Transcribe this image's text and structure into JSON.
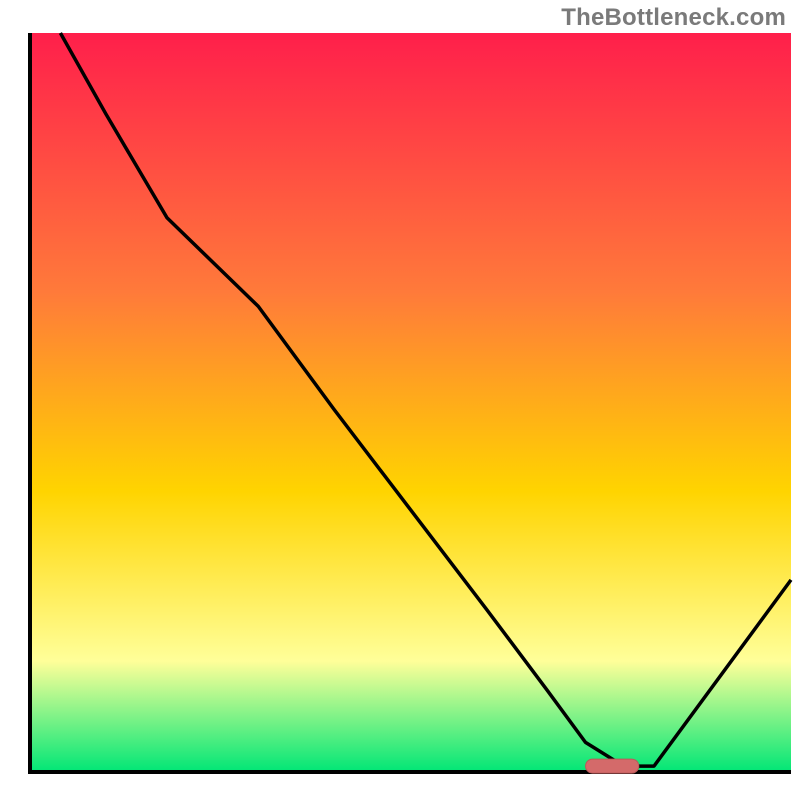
{
  "watermark": "TheBottleneck.com",
  "colors": {
    "gradient_top": "#ff1f4b",
    "gradient_mid1": "#ff7a3a",
    "gradient_mid2": "#ffd400",
    "gradient_pale": "#ffff99",
    "gradient_bottom": "#00e676",
    "axis": "#000000",
    "curve": "#000000",
    "marker_fill": "#d46a6a",
    "marker_stroke": "#bb5a5a"
  },
  "chart_data": {
    "type": "line",
    "title": "",
    "xlabel": "",
    "ylabel": "",
    "xlim": [
      0,
      100
    ],
    "ylim": [
      0,
      100
    ],
    "grid": false,
    "legend": null,
    "series": [
      {
        "name": "bottleneck-curve",
        "x": [
          4,
          10,
          18,
          25,
          30,
          40,
          50,
          60,
          68,
          73,
          78,
          82,
          100
        ],
        "y": [
          100,
          89,
          75,
          68,
          63,
          49,
          35.5,
          22,
          11,
          4,
          0.8,
          0.8,
          26
        ]
      }
    ],
    "marker": {
      "name": "optimal-range",
      "x_start": 73,
      "x_end": 80,
      "y": 0.8
    }
  }
}
